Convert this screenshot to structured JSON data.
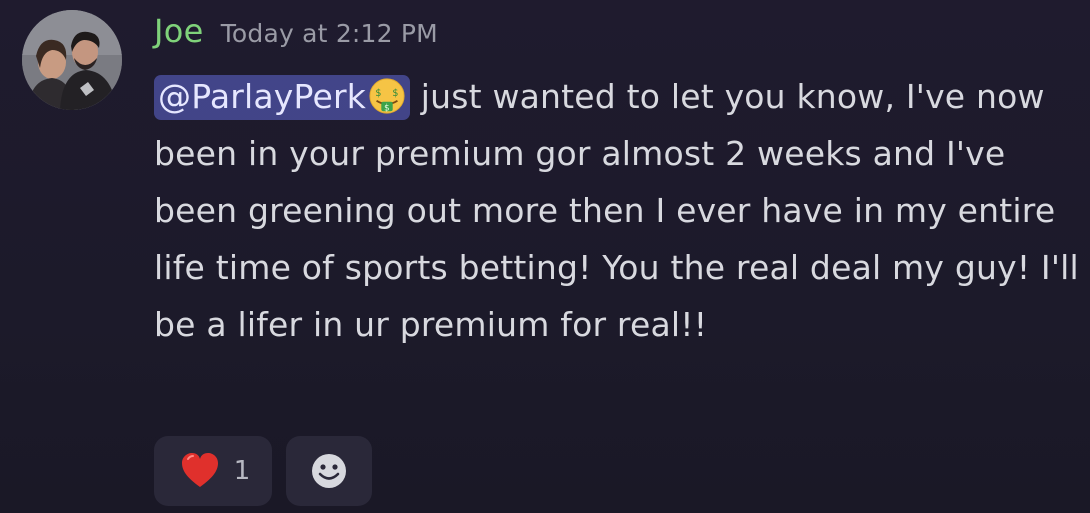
{
  "message": {
    "author": "Joe",
    "timestamp": "Today at 2:12 PM",
    "mention": "@ParlayPerk",
    "mention_emoji": "money-mouth-face",
    "text": "just wanted to let you know, I've now been in your premium gor almost 2 weeks and I've been greening out more then I ever have in my entire  life time of sports betting! You the real deal my guy! I'll be a lifer in ur premium for real!!"
  },
  "reactions": [
    {
      "icon": "red-heart",
      "count": "1"
    }
  ],
  "add_reaction_icon": "smiley-face",
  "colors": {
    "background": "#1d1a2b",
    "username": "#7fd27a",
    "mention_bg": "#5b60c8",
    "reaction_bg": "#2a2839"
  }
}
